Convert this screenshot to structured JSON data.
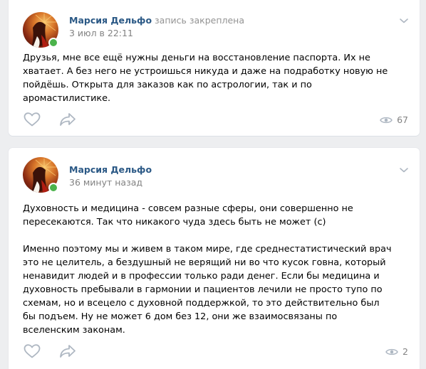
{
  "posts": [
    {
      "author": "Марсия Дельфо",
      "pinned_label": "запись закреплена",
      "date": "3 июл в 22:11",
      "paragraphs": [
        "Друзья, мне все ещё нужны деньги на восстановление паспорта. Их не хватает. А без него не устроишься никуда и даже на подработку новую не пойдёшь. Открыта для заказов как по астрологии, так и по аромастилистике."
      ],
      "views": "67"
    },
    {
      "author": "Марсия Дельфо",
      "date": "36 минут назад",
      "paragraphs": [
        "Духовность и медицина - совсем разные сферы, они совершенно не пересекаются. Так что никакого чуда здесь быть не может (с)",
        "Именно поэтому мы и живем в таком мире, где среднестатистический врач это не целитель, а бездушный не верящий ни во что кусок говна, который ненавидит людей и в профессии только ради денег. Если бы медицина и духовность пребывали в гармонии и пациентов лечили не просто тупо по схемам, но и всецело с духовной поддержкой, то это действительно был бы подъем. Ну не может 6 дом без 12, они же взаимосвязаны по вселенским законам."
      ],
      "views": "2"
    }
  ],
  "colors": {
    "background": "#edeef0",
    "card": "#ffffff",
    "author_link": "#2a5885",
    "meta_text": "#828282",
    "icon": "#aeb7c2",
    "online": "#4bb34b"
  },
  "icons": {
    "like": "heart-icon",
    "share": "share-arrow-icon",
    "views": "eye-icon",
    "menu": "chevron-down-icon"
  }
}
